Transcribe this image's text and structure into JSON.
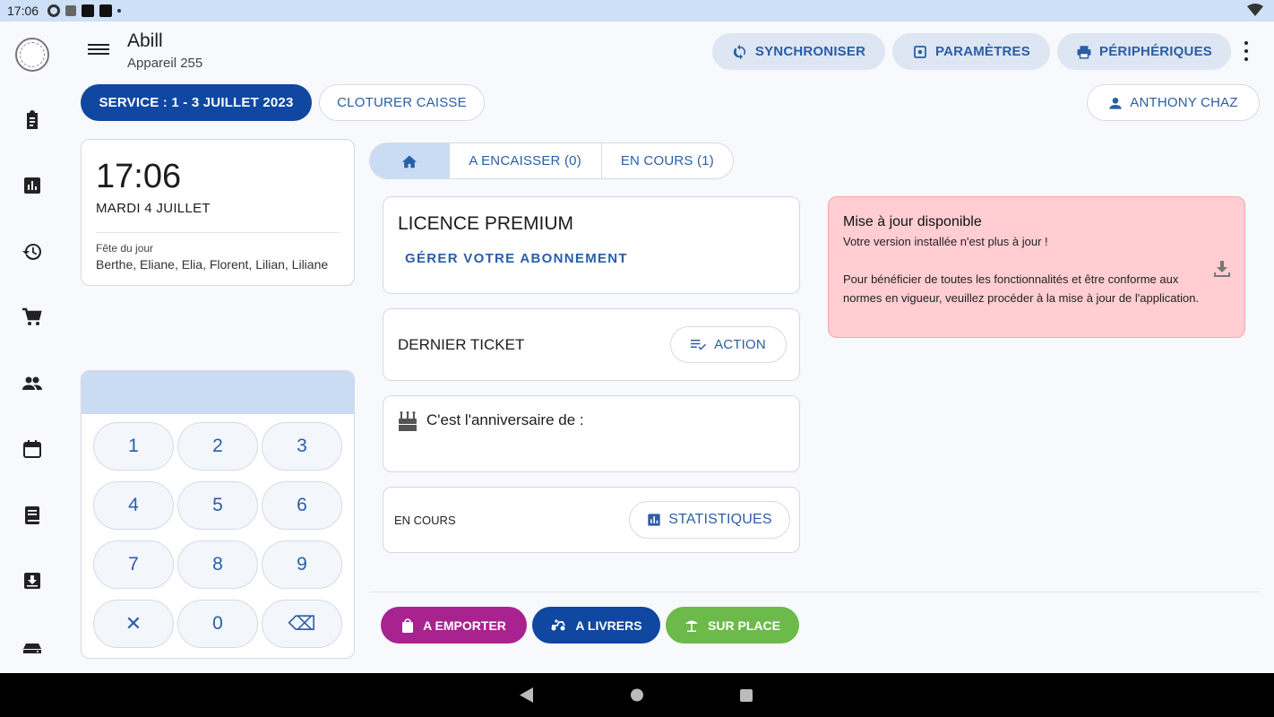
{
  "status_bar": {
    "time": "17:06"
  },
  "header": {
    "title": "Abill",
    "subtitle": "Appareil 255",
    "buttons": {
      "sync": "SYNCHRONISER",
      "params": "PARAMÈTRES",
      "devices": "PÉRIPHÉRIQUES"
    }
  },
  "service": {
    "service_label": "SERVICE : 1 - 3 JUILLET 2023",
    "close_label": "CLOTURER CAISSE",
    "user_label": "ANTHONY CHAZ"
  },
  "clock_card": {
    "time": "17:06",
    "date": "MARDI 4 JUILLET",
    "fete_label": "Fête du jour",
    "fete_names": "Berthe, Eliane, Elia, Florent, Lilian, Liliane"
  },
  "numpad": {
    "keys": [
      "1",
      "2",
      "3",
      "4",
      "5",
      "6",
      "7",
      "8",
      "9",
      "✕",
      "0",
      "⌫"
    ]
  },
  "tabs": {
    "encaisser": "A ENCAISSER (0)",
    "en_cours": "EN COURS (1)"
  },
  "licence": {
    "title": "LICENCE PREMIUM",
    "link": "GÉRER VOTRE ABONNEMENT"
  },
  "dernier_ticket": {
    "label": "DERNIER TICKET",
    "action": "ACTION"
  },
  "anniversaire": {
    "text": "C'est l'anniversaire de :"
  },
  "en_cours_card": {
    "label": "EN COURS",
    "stats": "STATISTIQUES"
  },
  "order_buttons": {
    "emporter": "A EMPORTER",
    "livrer": "A LIVRERS",
    "sur_place": "SUR PLACE"
  },
  "update_notice": {
    "title": "Mise à jour disponible",
    "line1": "Votre version installée n'est plus à jour !",
    "body": "Pour bénéficier de toutes les fonctionnalités et être conforme aux normes en vigueur, veuillez procéder à la mise à jour de l'application."
  },
  "colors": {
    "primary": "#0f47a1",
    "accent_text": "#2a5ea8",
    "tonal": "#dde6f2",
    "emporter": "#a8238f",
    "livrer": "#0f47a1",
    "sur_place": "#6cba4a",
    "notice_bg": "#ffcdd2"
  },
  "icons": {
    "rail": [
      "clipboard-icon",
      "bar-chart-icon",
      "history-icon",
      "cart-icon",
      "people-icon",
      "calendar-icon",
      "book-icon",
      "inbox-download-icon",
      "drive-icon"
    ]
  }
}
